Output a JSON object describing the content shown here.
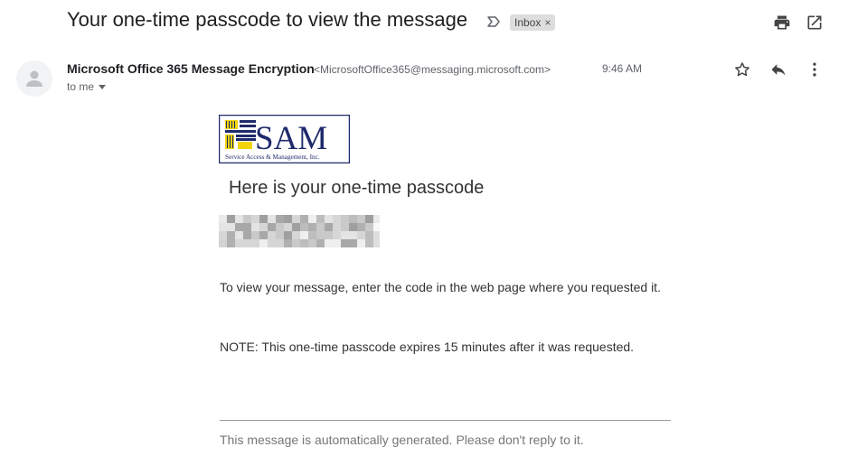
{
  "header": {
    "subject": "Your one-time passcode to view the message",
    "label_chip": "Inbox",
    "label_chip_close": "×"
  },
  "sender": {
    "name": "Microsoft Office 365 Message Encryption",
    "email": "<MicrosoftOffice365@messaging.microsoft.com>",
    "time": "9:46 AM",
    "recipient": "to me"
  },
  "body": {
    "logo": {
      "text": "SAM",
      "subtitle": "Service Access & Management, Inc.",
      "colors": {
        "navy": "#1f2a6b",
        "yellow": "#f2d40a"
      }
    },
    "heading": "Here is your one-time passcode",
    "instructions": "To view your message, enter the code in the web page where you requested it.",
    "note": "NOTE: This one-time passcode expires 15 minutes after it was requested.",
    "footer": "This message is automatically generated. Please don't reply to it."
  },
  "icons": {
    "print": "print-icon",
    "popout": "open-in-new-icon",
    "star": "star-icon",
    "reply": "reply-icon",
    "more": "more-vert-icon",
    "dropdown": "caret-down-icon",
    "label_marker": "label-arrow-icon"
  },
  "colors": {
    "text_primary": "#202124",
    "text_secondary": "#5f6368",
    "chip_bg": "#dddddd",
    "divider": "#9a9a9a"
  }
}
